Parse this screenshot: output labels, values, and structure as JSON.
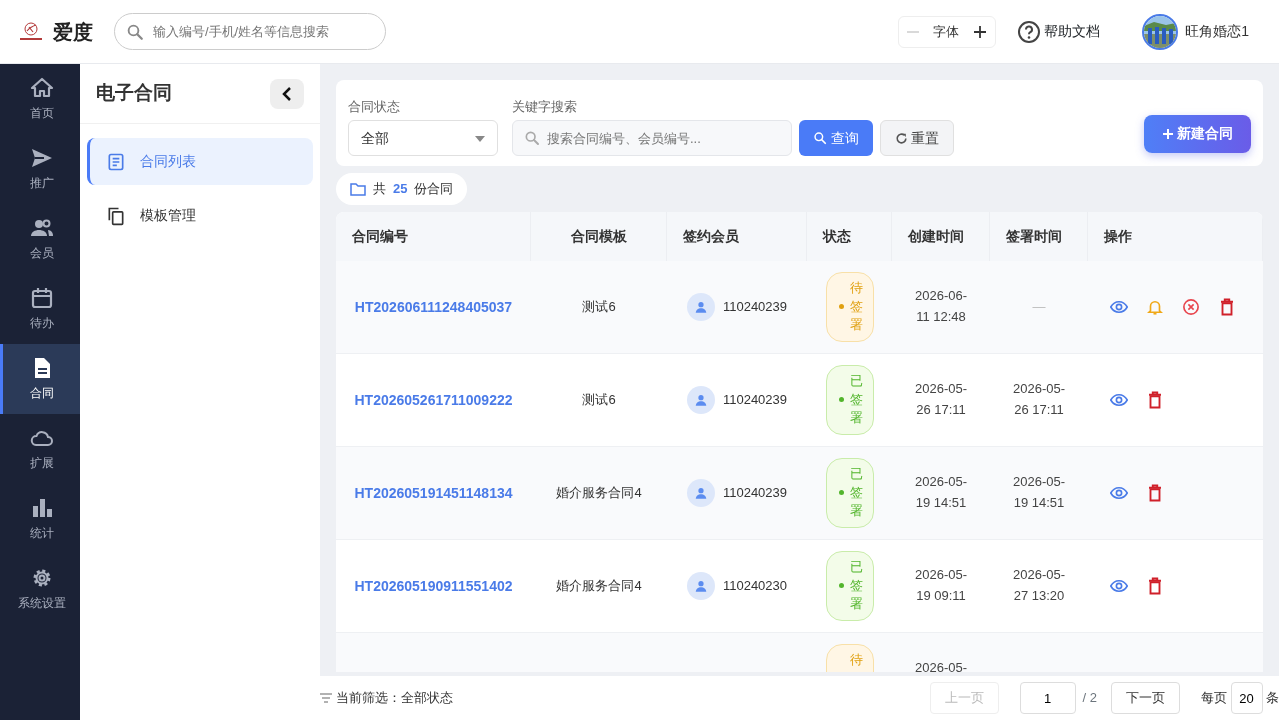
{
  "header": {
    "brand": "爱度",
    "search": {
      "placeholder": "输入编号/手机/姓名等信息搜索"
    },
    "font_control": {
      "label": "字体",
      "decrease_disabled": true
    },
    "help": "帮助文档",
    "user": "旺角婚恋1"
  },
  "nav": [
    {
      "label": "首页",
      "kind": "home",
      "selected": false
    },
    {
      "label": "推广",
      "kind": "send",
      "selected": false
    },
    {
      "label": "会员",
      "kind": "people",
      "selected": false
    },
    {
      "label": "待办",
      "kind": "calendar",
      "selected": false
    },
    {
      "label": "合同",
      "kind": "document",
      "selected": true
    },
    {
      "label": "扩展",
      "kind": "cloud",
      "selected": false
    },
    {
      "label": "统计",
      "kind": "chart",
      "selected": false
    },
    {
      "label": "系统设置",
      "kind": "gear",
      "selected": false
    }
  ],
  "subnav": {
    "title": "电子合同",
    "items": [
      {
        "label": "合同列表",
        "kind": "list",
        "selected": true
      },
      {
        "label": "模板管理",
        "kind": "copy",
        "selected": false
      }
    ]
  },
  "filters": {
    "status_label": "合同状态",
    "status_value": "全部",
    "keyword_label": "关键字搜索",
    "keyword_placeholder": "搜索合同编号、会员编号...",
    "query": "查询",
    "reset": "重置",
    "create": "新建合同"
  },
  "count": {
    "prefix": "共",
    "number": "25",
    "suffix": "份合同"
  },
  "table": {
    "columns": [
      "合同编号",
      "合同模板",
      "签约会员",
      "状态",
      "创建时间",
      "签署时间",
      "操作"
    ],
    "rows": [
      {
        "id": "HT202606111248405037",
        "template": "测试6",
        "member": "110240239",
        "status": {
          "kind": "pending",
          "label": "待签署"
        },
        "created": "2026-06-11 12:48",
        "signed": "—",
        "actions": [
          {
            "kind": "view"
          },
          {
            "kind": "remind"
          },
          {
            "kind": "cancel"
          },
          {
            "kind": "delete"
          }
        ]
      },
      {
        "id": "HT202605261711009222",
        "template": "测试6",
        "member": "110240239",
        "status": {
          "kind": "signed",
          "label": "已签署"
        },
        "created": "2026-05-26 17:11",
        "signed": "2026-05-26 17:11",
        "actions": [
          {
            "kind": "view"
          },
          {
            "kind": "delete"
          }
        ]
      },
      {
        "id": "HT202605191451148134",
        "template": "婚介服务合同4",
        "member": "110240239",
        "status": {
          "kind": "signed",
          "label": "已签署"
        },
        "created": "2026-05-19 14:51",
        "signed": "2026-05-19 14:51",
        "actions": [
          {
            "kind": "view"
          },
          {
            "kind": "delete"
          }
        ]
      },
      {
        "id": "HT202605190911551402",
        "template": "婚介服务合同4",
        "member": "110240230",
        "status": {
          "kind": "signed",
          "label": "已签署"
        },
        "created": "2026-05-19 09:11",
        "signed": "2026-05-27 13:20",
        "actions": [
          {
            "kind": "view"
          },
          {
            "kind": "delete"
          }
        ]
      },
      {
        "status": {
          "kind": "pending",
          "label": "待"
        },
        "created": "2026-05-"
      }
    ]
  },
  "footer": {
    "filter_label": "当前筛选：全部状态",
    "prev": "上一页",
    "prev_disabled": true,
    "page": "1",
    "total": "/ 2",
    "next": "下一页",
    "per_page_label": "每页",
    "per_page": "20",
    "unit": "条"
  }
}
